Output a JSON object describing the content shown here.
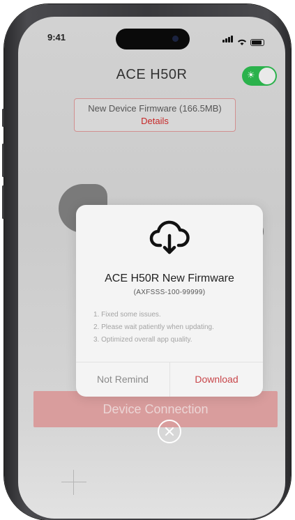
{
  "status_bar": {
    "time": "9:41"
  },
  "header": {
    "title": "ACE H50R",
    "toggle_on": true,
    "toggle_icon": "sun-icon",
    "toggle_color": "#2bb24c"
  },
  "firmware_banner": {
    "text": "New Device Firmware (166.5MB)",
    "link": "Details"
  },
  "connect_button": {
    "label": "Device Connection"
  },
  "dialog": {
    "icon": "cloud-download-icon",
    "title": "ACE H50R New Firmware",
    "subtitle": "(AXFSSS-100-99999)",
    "notes": [
      "1. Fixed some issues.",
      "2. Please wait patiently when updating.",
      "3. Optimized overall app quality."
    ],
    "buttons": {
      "not_remind": "Not Remind",
      "download": "Download"
    },
    "download_color": "#c8464a"
  },
  "close_icon": "close-icon"
}
